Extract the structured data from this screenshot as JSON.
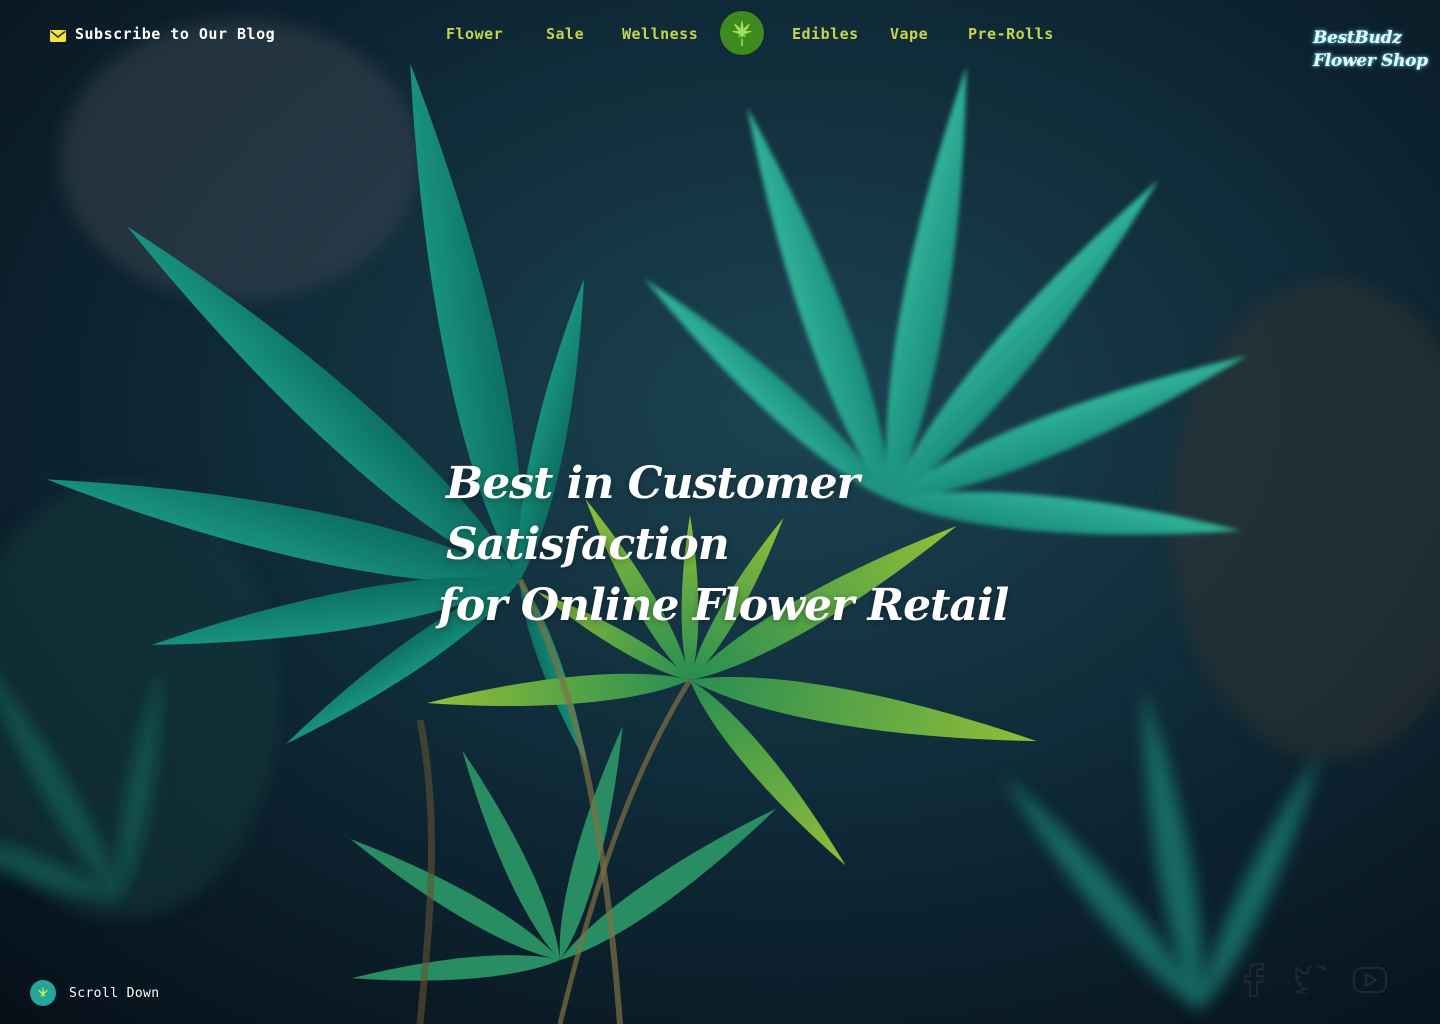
{
  "header": {
    "blog_link": "Subscribe to Our Blog",
    "nav": [
      {
        "label": "Flower"
      },
      {
        "label": "Sale"
      },
      {
        "label": "Wellness"
      },
      {
        "label": "Edibles"
      },
      {
        "label": "Vape"
      },
      {
        "label": "Pre-Rolls"
      }
    ],
    "brand_line1": "BestBudz",
    "brand_line2": "Flower Shop"
  },
  "hero": {
    "headline_line1": "Best in Customer Satisfaction",
    "headline_line2": "for Online Flower Retail"
  },
  "footer": {
    "scroll_label": "Scroll Down",
    "social_icons": [
      "facebook-icon",
      "twitter-icon",
      "youtube-icon"
    ]
  },
  "colors": {
    "nav_text": "#c8d44a",
    "logo_bg": "#3e8a1e",
    "scroll_badge": "#26a69a",
    "mail_icon": "#f5e23a"
  }
}
